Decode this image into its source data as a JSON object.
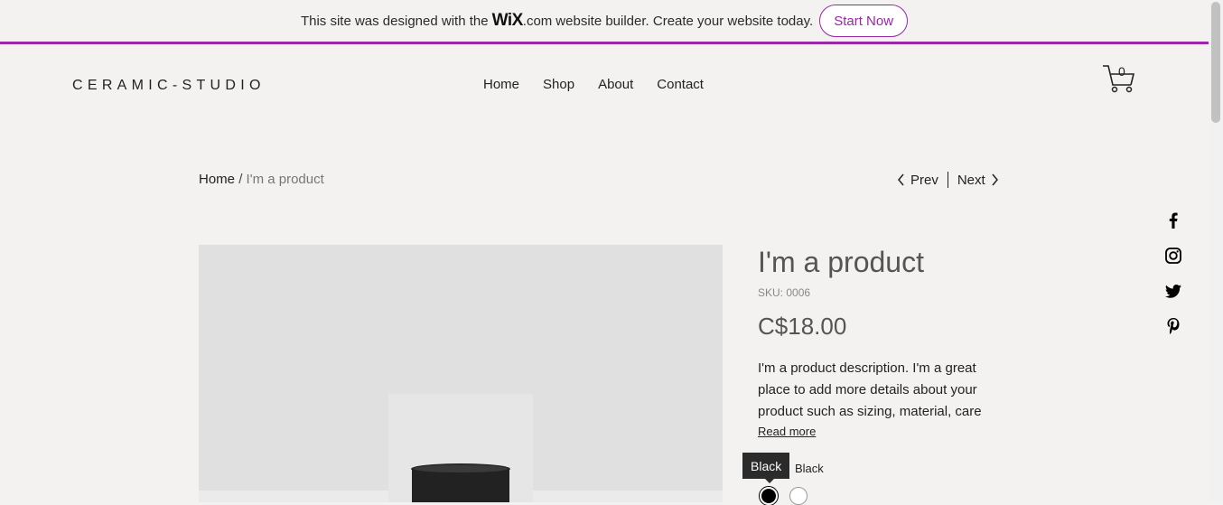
{
  "banner": {
    "text_before": "This site was designed with the",
    "logo_wix": "WiX",
    "logo_dotcom": ".com",
    "text_after": "website builder. Create your website today.",
    "cta_label": "Start Now",
    "accent_color": "#9a27a8"
  },
  "header": {
    "logo": "CERAMIC-STUDIO",
    "nav": [
      "Home",
      "Shop",
      "About",
      "Contact"
    ],
    "cart_count": "0",
    "cart_icon": "cart-icon"
  },
  "breadcrumb": {
    "home": "Home",
    "separator": "/",
    "current": "I'm a product"
  },
  "pager": {
    "prev_label": "Prev",
    "next_label": "Next"
  },
  "social": [
    "facebook-icon",
    "instagram-icon",
    "twitter-icon",
    "pinterest-icon"
  ],
  "product": {
    "title": "I'm a product",
    "sku": "SKU: 0006",
    "price": "C$18.00",
    "description": "I'm a product description. I'm a great place to add more details about your product such as sizing, material, care",
    "read_more": "Read more",
    "color_label": "Black",
    "tooltip": "Black",
    "swatches": [
      "#000000",
      "#ffffff"
    ]
  }
}
